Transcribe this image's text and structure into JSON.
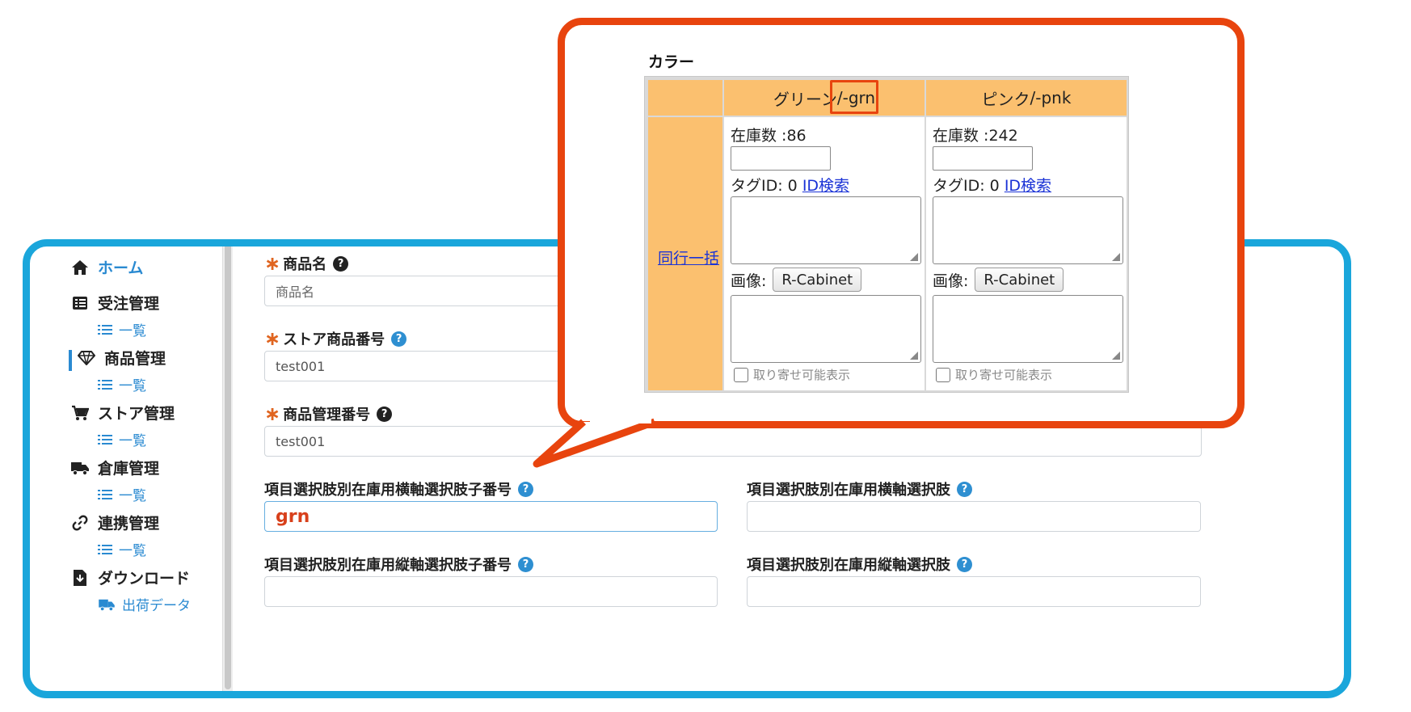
{
  "sidebar": {
    "items": [
      {
        "label": "ホーム",
        "icon": "home-icon"
      },
      {
        "label": "受注管理",
        "icon": "table-icon",
        "sub": "一覧"
      },
      {
        "label": "商品管理",
        "icon": "diamond-icon",
        "sub": "一覧",
        "active": true
      },
      {
        "label": "ストア管理",
        "icon": "cart-icon",
        "sub": "一覧"
      },
      {
        "label": "倉庫管理",
        "icon": "truck-icon",
        "sub": "一覧"
      },
      {
        "label": "連携管理",
        "icon": "link-icon",
        "sub": "一覧"
      },
      {
        "label": "ダウンロード",
        "icon": "file-download-icon",
        "sub": "出荷データ",
        "sub_icon": "truck-icon"
      }
    ],
    "sub_icon": "list-icon"
  },
  "form": {
    "product_name": {
      "label": "商品名",
      "placeholder": "商品名"
    },
    "store_product_no": {
      "label": "ストア商品番号",
      "value": "test001"
    },
    "product_mgmt_no": {
      "label": "商品管理番号",
      "value": "test001"
    },
    "h_axis_child_no": {
      "label": "項目選択肢別在庫用横軸選択肢子番号",
      "value": "grn"
    },
    "h_axis_choice": {
      "label": "項目選択肢別在庫用横軸選択肢",
      "value": ""
    },
    "v_axis_child_no": {
      "label": "項目選択肢別在庫用縦軸選択肢子番号",
      "value": ""
    },
    "v_axis_choice": {
      "label": "項目選択肢別在庫用縦軸選択肢",
      "value": ""
    }
  },
  "callout": {
    "title": "カラー",
    "row_action": "同行一括",
    "columns": [
      {
        "header_name": "グリーン",
        "header_code": "/-grn",
        "stock": "在庫数 :86",
        "tag_label": "タグID: 0",
        "tag_link": "ID検索",
        "image_label": "画像:",
        "image_button": "R-Cabinet",
        "checkbox_label": "取り寄せ可能表示"
      },
      {
        "header_name": "ピンク",
        "header_code": "/-pnk",
        "stock": "在庫数 :242",
        "tag_label": "タグID: 0",
        "tag_link": "ID検索",
        "image_label": "画像:",
        "image_button": "R-Cabinet",
        "checkbox_label": "取り寄せ可能表示"
      }
    ]
  },
  "colors": {
    "frame_blue": "#1aa6db",
    "callout_red": "#e8440e",
    "header_orange": "#fbc06f",
    "link_blue": "#1b33d6"
  }
}
